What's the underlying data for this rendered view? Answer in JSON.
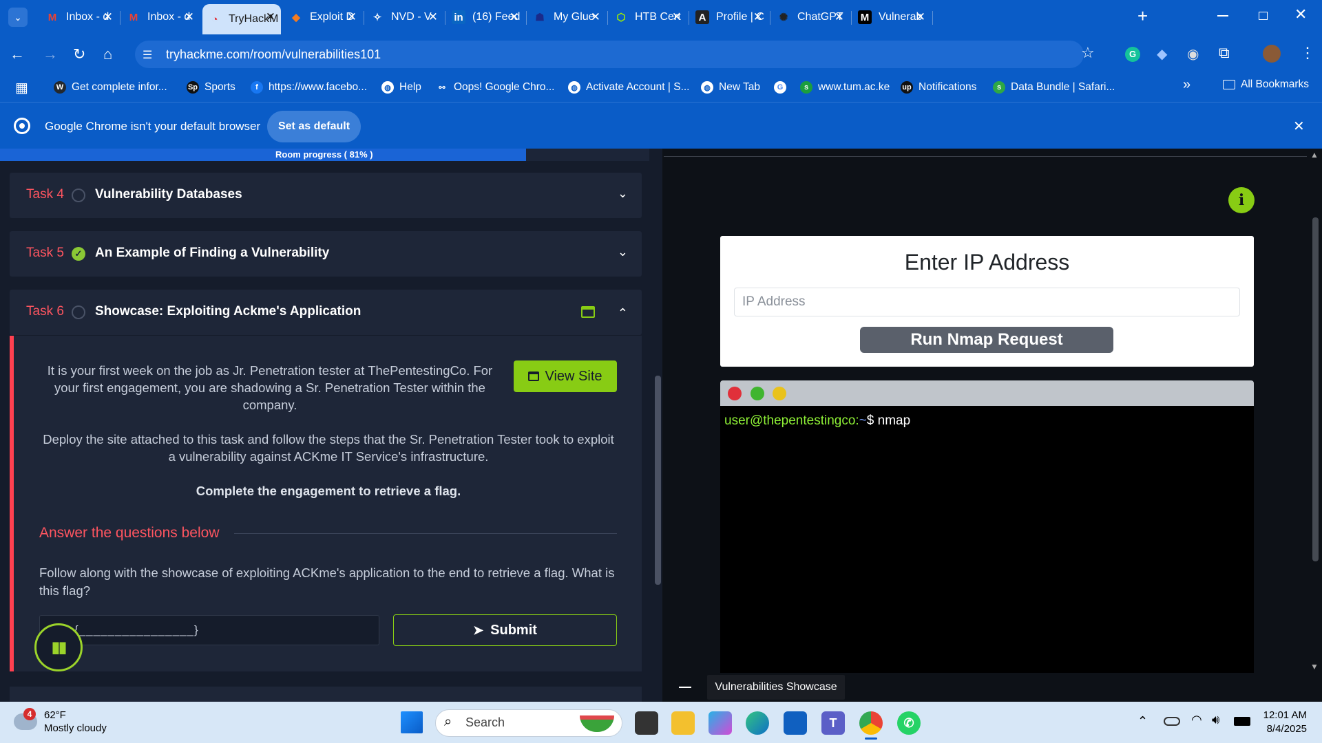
{
  "browser": {
    "tabs": [
      {
        "label": "Inbox - d",
        "icon": "gmail-icon"
      },
      {
        "label": "Inbox - d",
        "icon": "gmail-icon"
      },
      {
        "label": "TryHackM",
        "icon": "tryhackme-icon",
        "active": true
      },
      {
        "label": "Exploit D",
        "icon": "exploitdb-icon"
      },
      {
        "label": "NVD - V",
        "icon": "nvd-icon"
      },
      {
        "label": "(16) Feed",
        "icon": "linkedin-icon"
      },
      {
        "label": "My Glue",
        "icon": "glue-icon"
      },
      {
        "label": "HTB Cert",
        "icon": "htb-icon"
      },
      {
        "label": "Profile | C",
        "icon": "profile-icon"
      },
      {
        "label": "ChatGPT",
        "icon": "chatgpt-icon"
      },
      {
        "label": "Vulnerab",
        "icon": "medium-icon"
      }
    ],
    "url": "tryhackme.com/room/vulnerabilities101",
    "bookmarks": [
      {
        "label": "Get complete infor...",
        "icon": "wordpress-icon"
      },
      {
        "label": "Sports",
        "icon": "sp-icon"
      },
      {
        "label": "https://www.facebo...",
        "icon": "facebook-icon"
      },
      {
        "label": "Help",
        "icon": "globe-icon"
      },
      {
        "label": "Oops! Google Chro...",
        "icon": "link-icon"
      },
      {
        "label": "Activate Account | S...",
        "icon": "globe-icon"
      },
      {
        "label": "New Tab",
        "icon": "globe-icon"
      },
      {
        "label": "",
        "icon": "google-icon"
      },
      {
        "label": "www.tum.ac.ke",
        "icon": "s-icon"
      },
      {
        "label": "Notifications",
        "icon": "upwork-icon"
      },
      {
        "label": "Data Bundle | Safari...",
        "icon": "safaricom-icon"
      }
    ],
    "all_bookmarks": "All Bookmarks",
    "infobar": {
      "message": "Google Chrome isn't your default browser",
      "button": "Set as default"
    }
  },
  "room": {
    "progress_text": "Room progress ( 81% )",
    "progress_fraction": 0.81,
    "tasks": [
      {
        "num": "Task 4",
        "title": "Vulnerability Databases",
        "done": false
      },
      {
        "num": "Task 5",
        "title": "An Example of Finding a Vulnerability",
        "done": true
      },
      {
        "num": "Task 6",
        "title": "Showcase: Exploiting Ackme's Application",
        "done": false
      }
    ],
    "task6": {
      "para1": "It is your first week on the job as Jr. Penetration tester at ThePentestingCo. For your first engagement, you are shadowing a Sr. Penetration Tester within the company.",
      "para2": "Deploy the site attached to this task and follow the steps that the Sr. Penetration Tester took to exploit a vulnerability against ACKme IT Service's infrastructure.",
      "para3": "Complete the engagement to retrieve a flag.",
      "view_site": "View Site",
      "answer_heading": "Answer the questions below",
      "question": "Follow along with the showcase of exploiting ACKme's application to the end to retrieve a flag. What is this flag?",
      "answer_mask": "{________________}",
      "submit": "Submit"
    }
  },
  "site": {
    "title": "Enter IP Address",
    "ip_placeholder": "IP Address",
    "button": "Run Nmap Request",
    "terminal_user": "user@thepentestingco:",
    "terminal_path": "~",
    "terminal_cmd": "$ nmap",
    "tooltip": "Vulnerabilities Showcase"
  },
  "taskbar": {
    "weather_temp": "62°F",
    "weather_desc": "Mostly cloudy",
    "weather_badge": "4",
    "search": "Search",
    "time": "12:01 AM",
    "date": "8/4/2025"
  },
  "colors": {
    "accent": "#88cc14",
    "task_red": "#ff5560",
    "chrome_blue": "#0a5cc7"
  }
}
